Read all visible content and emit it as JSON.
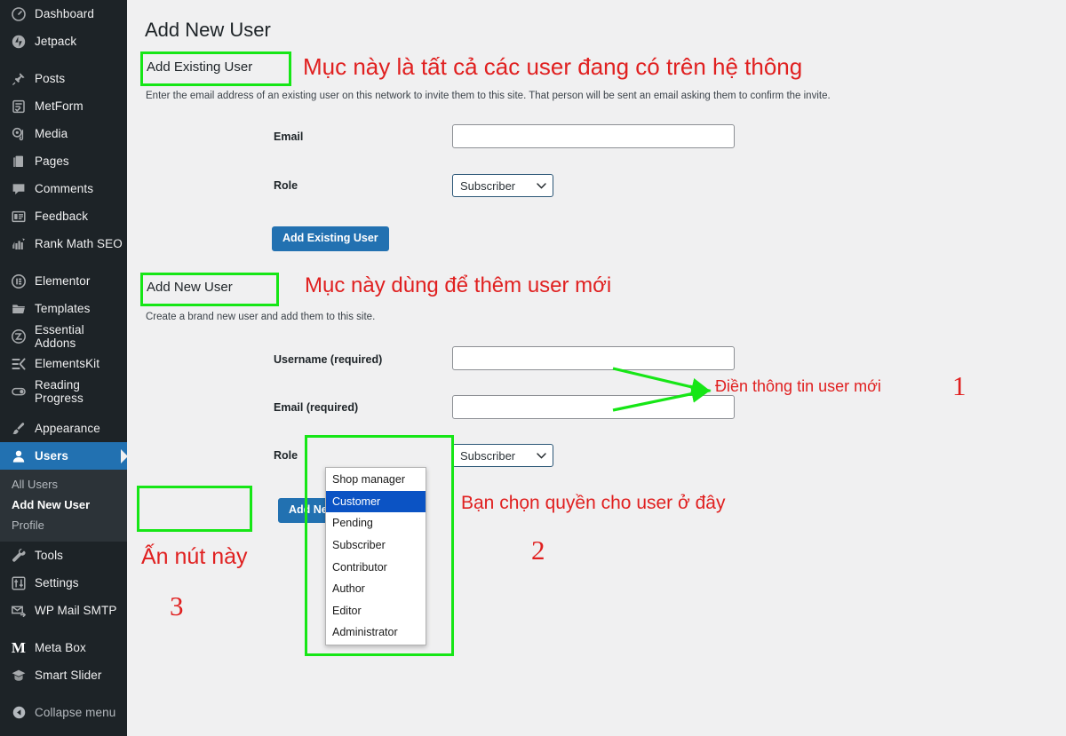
{
  "sidebar": {
    "items": [
      {
        "label": "Dashboard",
        "icon": "dashboard-icon",
        "current": false,
        "gap_after": false
      },
      {
        "label": "Jetpack",
        "icon": "jetpack-icon",
        "current": false,
        "gap_after": true
      },
      {
        "label": "Posts",
        "icon": "pin-icon",
        "current": false,
        "gap_after": false
      },
      {
        "label": "MetForm",
        "icon": "metform-icon",
        "current": false,
        "gap_after": false
      },
      {
        "label": "Media",
        "icon": "media-icon",
        "current": false,
        "gap_after": false
      },
      {
        "label": "Pages",
        "icon": "pages-icon",
        "current": false,
        "gap_after": false
      },
      {
        "label": "Comments",
        "icon": "comment-bubble-icon",
        "current": false,
        "gap_after": false
      },
      {
        "label": "Feedback",
        "icon": "feedback-icon",
        "current": false,
        "gap_after": false
      },
      {
        "label": "Rank Math SEO",
        "icon": "rank-math-icon",
        "current": false,
        "gap_after": true
      },
      {
        "label": "Elementor",
        "icon": "elementor-icon",
        "current": false,
        "gap_after": false
      },
      {
        "label": "Templates",
        "icon": "folder-icon",
        "current": false,
        "gap_after": false
      },
      {
        "label": "Essential Addons",
        "icon": "essential-addons-icon",
        "current": false,
        "gap_after": false
      },
      {
        "label": "ElementsKit",
        "icon": "elementskit-icon",
        "current": false,
        "gap_after": false
      },
      {
        "label": "Reading Progress",
        "icon": "toggle-icon",
        "current": false,
        "gap_after": true
      },
      {
        "label": "Appearance",
        "icon": "paintbrush-icon",
        "current": false,
        "gap_after": false
      },
      {
        "label": "Users",
        "icon": "user-icon",
        "current": true,
        "gap_after": false
      }
    ],
    "submenu": [
      {
        "label": "All Users",
        "current": false
      },
      {
        "label": "Add New User",
        "current": true
      },
      {
        "label": "Profile",
        "current": false
      }
    ],
    "items_after": [
      {
        "label": "Tools",
        "icon": "wrench-icon",
        "current": false,
        "gap_after": false
      },
      {
        "label": "Settings",
        "icon": "settings-icon",
        "current": false,
        "gap_after": false
      },
      {
        "label": "WP Mail SMTP",
        "icon": "mail-icon",
        "current": false,
        "gap_after": true
      },
      {
        "label": "Meta Box",
        "icon": "metabox-m-icon",
        "current": false,
        "gap_after": false
      },
      {
        "label": "Smart Slider",
        "icon": "smart-slider-icon",
        "current": false,
        "gap_after": false
      }
    ],
    "collapse": {
      "label": "Collapse menu",
      "icon": "collapse-arrow-icon"
    }
  },
  "page": {
    "title": "Add New User"
  },
  "add_existing": {
    "heading": "Add Existing User",
    "description": "Enter the email address of an existing user on this network to invite them to this site. That person will be sent an email asking them to confirm the invite.",
    "email_label": "Email",
    "email_value": "",
    "email_placeholder": "",
    "role_label": "Role",
    "role_value": "Subscriber",
    "submit_label": "Add Existing User"
  },
  "add_new": {
    "heading": "Add New User",
    "description": "Create a brand new user and add them to this site.",
    "username_label": "Username (required)",
    "username_value": "",
    "username_placeholder": "",
    "email_label": "Email (required)",
    "email_value": "",
    "email_placeholder": "",
    "role_label": "Role",
    "role_value": "Subscriber",
    "submit_label": "Add New User",
    "role_options": [
      {
        "label": "Shop manager",
        "selected": false
      },
      {
        "label": "Customer",
        "selected": true
      },
      {
        "label": "Pending",
        "selected": false
      },
      {
        "label": "Subscriber",
        "selected": false
      },
      {
        "label": "Contributor",
        "selected": false
      },
      {
        "label": "Author",
        "selected": false
      },
      {
        "label": "Editor",
        "selected": false
      },
      {
        "label": "Administrator",
        "selected": false
      }
    ]
  },
  "annotations": {
    "note_existing": "Mục này là tất cả các user đang có trên hệ thông",
    "note_add_new": "Mục này dùng để thêm user mới",
    "note_fill_info": "Điền thông tin user mới",
    "note_choose_role": "Bạn chọn quyền cho user ở đây",
    "note_press_button": "Ấn nút này",
    "num_1": "1",
    "num_2": "2",
    "num_3": "3",
    "highlight_color": "#16e616",
    "text_color": "#e02020"
  },
  "colors": {
    "sidebar_bg": "#1d2327",
    "sidebar_submenu_bg": "#2c3338",
    "accent_blue": "#2271b1",
    "option_highlight": "#0b53c4",
    "content_bg": "#f0f0f1"
  }
}
